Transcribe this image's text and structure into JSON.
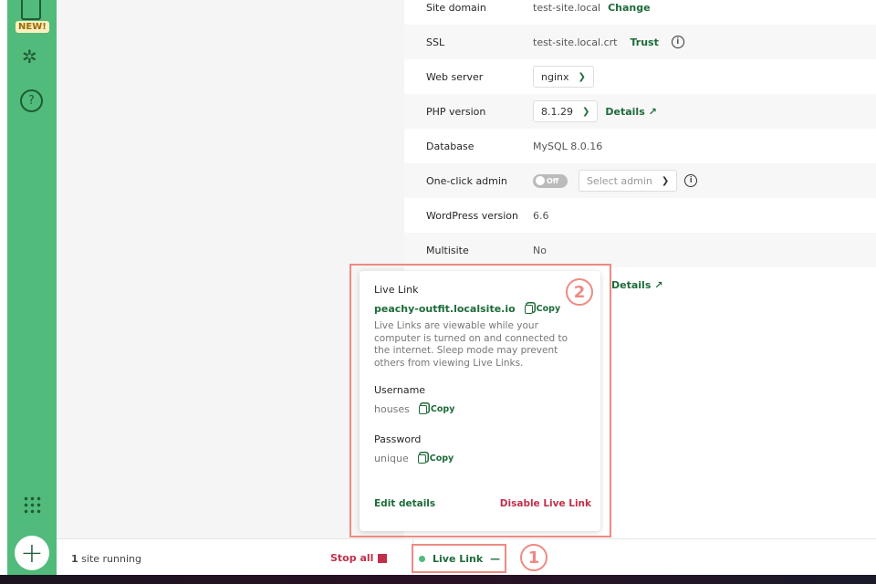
{
  "sidebar": {
    "new_badge": "NEW!",
    "icons": [
      "book-icon",
      "puzzle-icon",
      "help-icon",
      "grid-icon",
      "plus-icon"
    ]
  },
  "settings": [
    {
      "label": "Site domain",
      "value": "test-site.local",
      "action": "Change"
    },
    {
      "label": "SSL",
      "value": "test-site.local.crt",
      "action": "Trust"
    },
    {
      "label": "Web server",
      "select": "nginx"
    },
    {
      "label": "PHP version",
      "select": "8.1.29",
      "action": "Details"
    },
    {
      "label": "Database",
      "value": "MySQL 8.0.16"
    },
    {
      "label": "One-click admin",
      "toggle": "Off",
      "select": "Select admin"
    },
    {
      "label": "WordPress version",
      "value": "6.6"
    },
    {
      "label": "Multisite",
      "value": "No"
    },
    {
      "action": "Details"
    }
  ],
  "popover": {
    "title": "Live Link",
    "url": "peachy-outfit.localsite.io",
    "copy": "Copy",
    "description": "Live Links are viewable while your computer is turned on and connected to the internet. Sleep mode may prevent others from viewing Live Links.",
    "username_label": "Username",
    "username": "houses",
    "password_label": "Password",
    "password": "unique",
    "edit": "Edit details",
    "disable": "Disable Live Link"
  },
  "footer": {
    "count": "1",
    "running": "site running",
    "stop_all": "Stop all",
    "live_link": "Live Link",
    "live_dash": "—"
  },
  "annotations": [
    "1",
    "2"
  ],
  "colors": {
    "sidebar": "#51bb7b",
    "accent": "#1d6b39",
    "danger": "#c0304a",
    "annotation": "#ee8a82"
  }
}
